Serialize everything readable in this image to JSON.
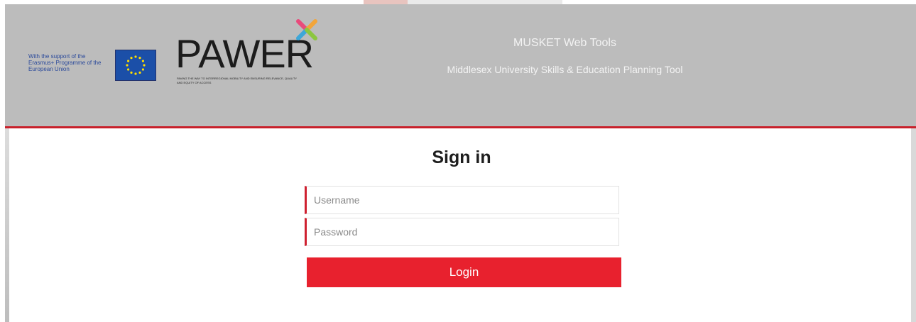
{
  "header": {
    "support_text": "With the support of the Erasmus+ Programme of the European Union",
    "brand": "PAWER",
    "brand_tagline": "Paving the way to interregional mobility and ensuring relevance, quality and equity of access",
    "title": "MUSKET Web Tools",
    "subtitle": "Middlesex University Skills & Education Planning Tool"
  },
  "signin": {
    "heading": "Sign in",
    "username_placeholder": "Username",
    "password_placeholder": "Password",
    "login_label": "Login"
  },
  "colors": {
    "header_bg": "#bcbcbc",
    "accent": "#e8212e",
    "eu_blue": "#1b4fa8",
    "eu_star": "#ffdd00"
  },
  "icons": {
    "eu_flag": "eu-flag-icon",
    "pawer_mark": "pawer-cross-icon"
  }
}
